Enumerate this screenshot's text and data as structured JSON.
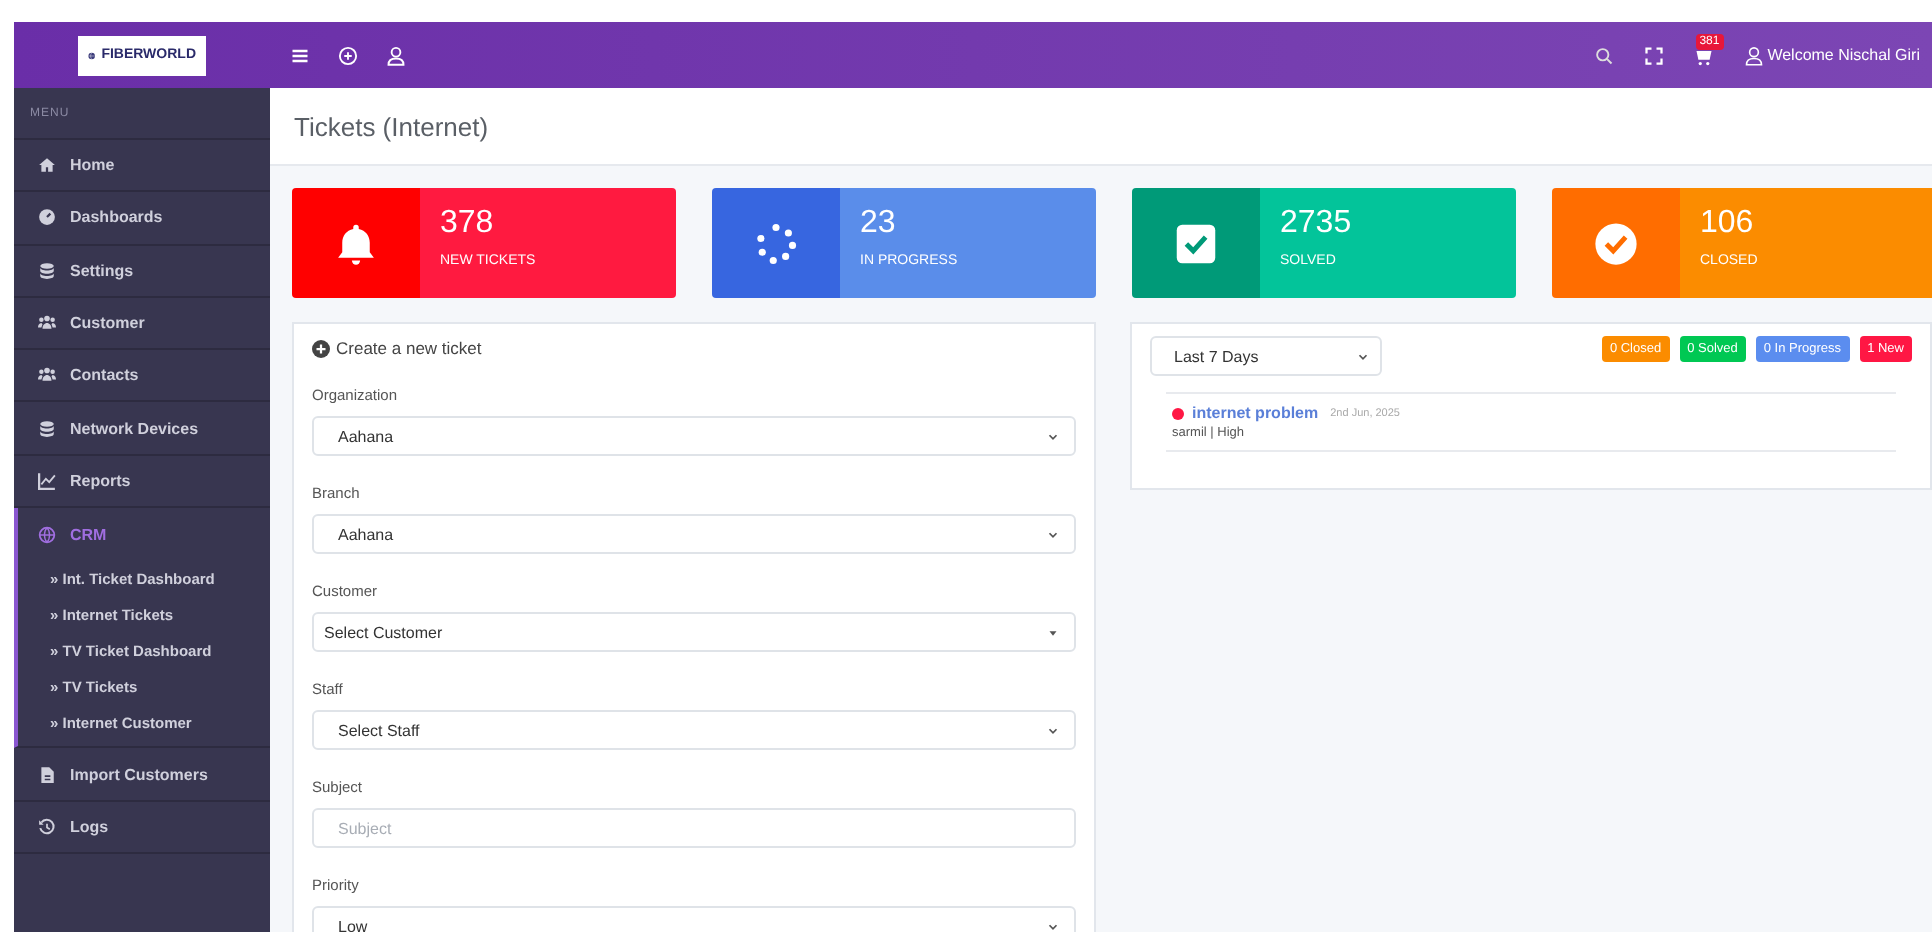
{
  "topbar": {
    "logo": "FIBERWORLD",
    "cart_count": "381",
    "welcome": "Welcome Nischal Giri"
  },
  "sidebar": {
    "heading": "MENU",
    "items": [
      {
        "label": "Home",
        "selected": false
      },
      {
        "label": "Dashboards",
        "selected": false
      },
      {
        "label": "Settings",
        "selected": false
      },
      {
        "label": "Customer",
        "selected": false
      },
      {
        "label": "Contacts",
        "selected": false
      },
      {
        "label": "Network Devices",
        "selected": false
      },
      {
        "label": "Reports",
        "selected": false
      },
      {
        "label": "CRM",
        "selected": true,
        "expanded": true,
        "children": [
          {
            "label": "» Int. Ticket Dashboard",
            "selected": false
          },
          {
            "label": "» Internet Tickets",
            "selected": false
          },
          {
            "label": "» TV Ticket Dashboard",
            "selected": false
          },
          {
            "label": "» TV Tickets",
            "selected": false
          },
          {
            "label": "» Internet Customer",
            "selected": false
          }
        ]
      },
      {
        "label": "Import Customers",
        "selected": false
      },
      {
        "label": "Logs",
        "selected": false
      }
    ]
  },
  "page_title": "Tickets (Internet)",
  "stats": [
    {
      "value": "378",
      "label": "NEW TICKETS",
      "kind": "new"
    },
    {
      "value": "23",
      "label": "IN PROGRESS",
      "kind": "progress"
    },
    {
      "value": "2735",
      "label": "SOLVED",
      "kind": "solved"
    },
    {
      "value": "106",
      "label": "CLOSED",
      "kind": "closed"
    }
  ],
  "form": {
    "title": "Create a new ticket",
    "fields": [
      {
        "label": "Organization",
        "kind": "select",
        "value": "Aahana"
      },
      {
        "label": "Branch",
        "kind": "select",
        "value": "Aahana"
      },
      {
        "label": "Customer",
        "kind": "search-select",
        "value": "Select Customer"
      },
      {
        "label": "Staff",
        "kind": "select",
        "value": "Select Staff"
      },
      {
        "label": "Subject",
        "kind": "text",
        "placeholder": "Subject"
      },
      {
        "label": "Priority",
        "kind": "select",
        "value": "Low"
      }
    ]
  },
  "recent": {
    "period": "Last 7 Days",
    "badges": [
      {
        "text": "0 Closed",
        "color": "#fb8c00"
      },
      {
        "text": "0 Solved",
        "color": "#00c853"
      },
      {
        "text": "0 In Progress",
        "color": "#5b8def"
      },
      {
        "text": "1 New",
        "color": "#ff1744"
      }
    ],
    "tickets": [
      {
        "title": "internet problem",
        "date": "2nd Jun, 2025",
        "meta": "sarmil | High",
        "color": "#ff1744"
      }
    ]
  }
}
